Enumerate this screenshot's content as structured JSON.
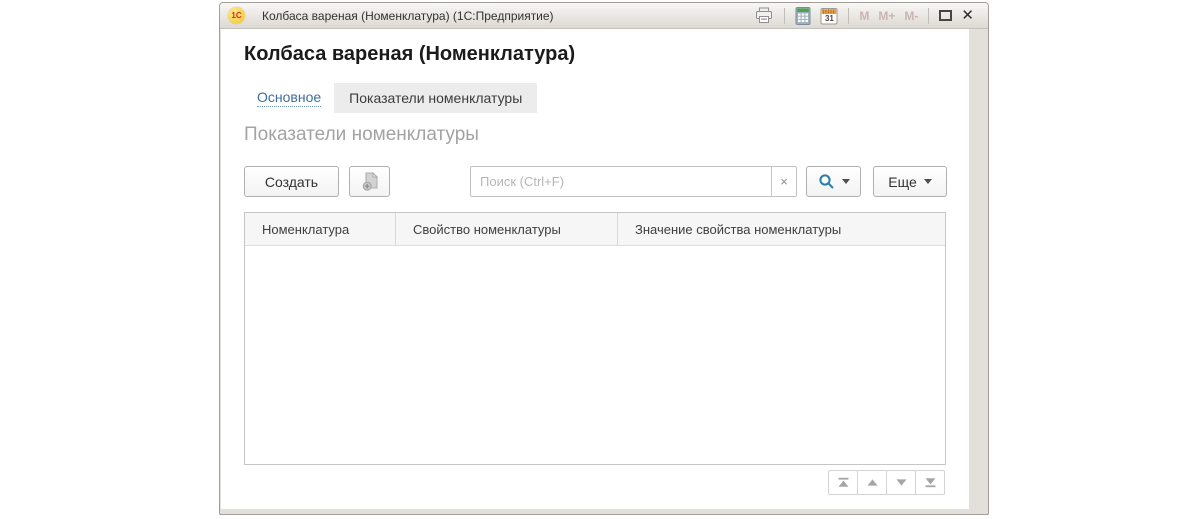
{
  "window": {
    "logo_text": "1С",
    "title": "Колбаса вареная (Номенклатура)  (1С:Предприятие)",
    "calendar_day": "31",
    "memory_buttons": [
      "M",
      "M+",
      "M-"
    ],
    "close_symbol": "✕"
  },
  "page": {
    "title": "Колбаса вареная (Номенклатура)",
    "breadcrumb_link": "Основное",
    "active_tab": "Показатели номенклатуры",
    "section_heading": "Показатели номенклатуры"
  },
  "toolbar": {
    "create_button": "Создать",
    "search_placeholder": "Поиск (Ctrl+F)",
    "clear_search": "×",
    "more_button": "Еще"
  },
  "table": {
    "columns": [
      "Номенклатура",
      "Свойство номенклатуры",
      "Значение свойства номенклатуры"
    ],
    "rows": []
  },
  "colors": {
    "link_blue": "#3b6ea5",
    "search_icon_blue": "#2b7cab",
    "titlebar_top": "#f8f7f5",
    "titlebar_bottom": "#ddd9d4",
    "tab_bg": "#ececec",
    "heading_gray": "#a3a3a3"
  }
}
